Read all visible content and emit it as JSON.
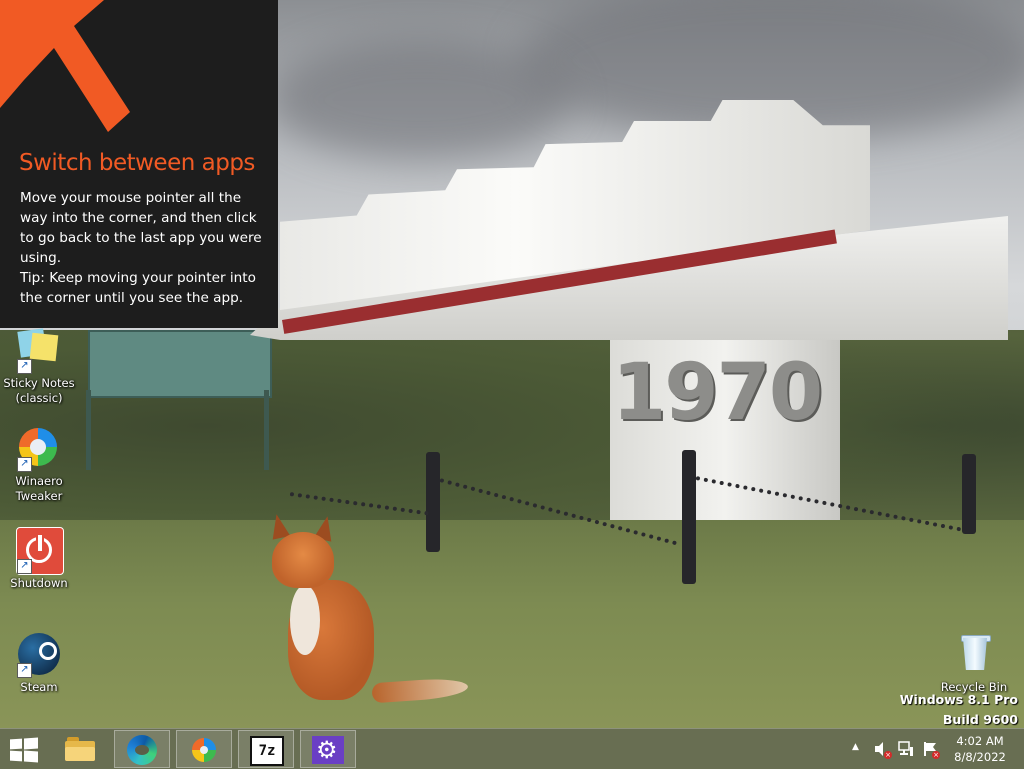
{
  "charm_hint": {
    "title": "Switch between apps",
    "body": "Move your mouse pointer all the way into the corner, and then click to go back to the last app you were using.",
    "tip": "Tip: Keep moving your pointer into the corner until you see the app.",
    "accent_color": "#f15a24"
  },
  "wallpaper": {
    "monument_year": "1970"
  },
  "desktop_icons": [
    {
      "label": "Sticky Notes (classic)",
      "icon": "sticky-notes-icon"
    },
    {
      "label": "Winaero Tweaker",
      "icon": "winaero-tweaker-icon"
    },
    {
      "label": "Shutdown",
      "icon": "shutdown-icon"
    },
    {
      "label": "Steam",
      "icon": "steam-icon"
    },
    {
      "label": "Recycle Bin",
      "icon": "recycle-bin-icon"
    }
  ],
  "watermark": {
    "line1": "Windows 8.1 Pro",
    "line2": "Build 9600"
  },
  "taskbar": {
    "start_icon": "windows-logo-icon",
    "buttons": [
      {
        "name": "File Explorer",
        "icon": "file-explorer-icon"
      },
      {
        "name": "Microsoft Edge",
        "icon": "edge-icon"
      },
      {
        "name": "Winaero Tweaker",
        "icon": "winaero-tweaker-icon"
      },
      {
        "name": "7-Zip",
        "icon": "seven-zip-icon",
        "glyph": "7z"
      },
      {
        "name": "Settings",
        "icon": "gear-icon",
        "glyph": "⚙"
      }
    ],
    "tray": {
      "overflow_glyph": "▲",
      "icons": [
        "volume-muted-icon",
        "network-icon",
        "action-center-icon"
      ],
      "time": "4:02 AM",
      "date": "8/8/2022"
    }
  }
}
